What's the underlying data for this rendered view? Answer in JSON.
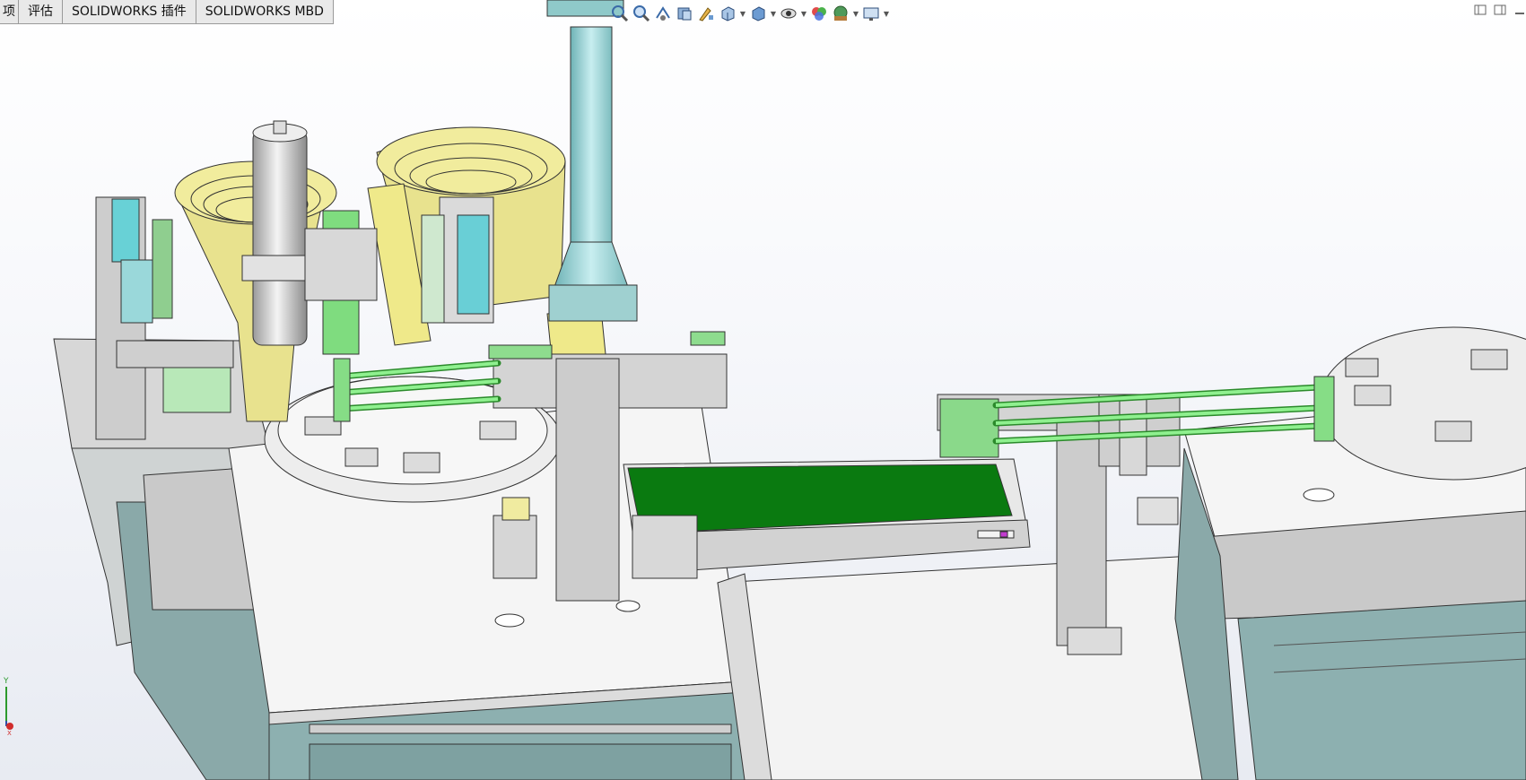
{
  "tabs": [
    {
      "label": "项"
    },
    {
      "label": "评估"
    },
    {
      "label": "SOLIDWORKS 插件"
    },
    {
      "label": "SOLIDWORKS MBD"
    }
  ],
  "heads_up_toolbar": [
    {
      "icon": "zoom-to-fit-icon"
    },
    {
      "icon": "zoom-to-area-icon"
    },
    {
      "icon": "previous-view-icon"
    },
    {
      "icon": "section-view-icon"
    },
    {
      "icon": "dynamic-annotation-views-icon"
    },
    {
      "icon": "view-orientation-icon"
    },
    {
      "icon": "display-style-icon"
    },
    {
      "icon": "hide-show-items-icon"
    },
    {
      "icon": "edit-appearance-icon"
    },
    {
      "icon": "apply-scene-icon"
    },
    {
      "icon": "view-settings-icon"
    }
  ],
  "window_controls": [
    {
      "icon": "restore-left-icon"
    },
    {
      "icon": "restore-right-icon"
    },
    {
      "icon": "minimize-icon"
    }
  ],
  "triad": {
    "y_label": "Y",
    "x_label": "X"
  },
  "colors": {
    "machine_gray": "#c8c8c8",
    "table_white": "#f4f4f4",
    "cabinet_teal": "#8fb3b3",
    "bowl_yellow": "#e6e08e",
    "rail_green": "#7fe07f",
    "conveyor_green": "#0a7a10",
    "column_cyan": "#9fd8d8"
  }
}
